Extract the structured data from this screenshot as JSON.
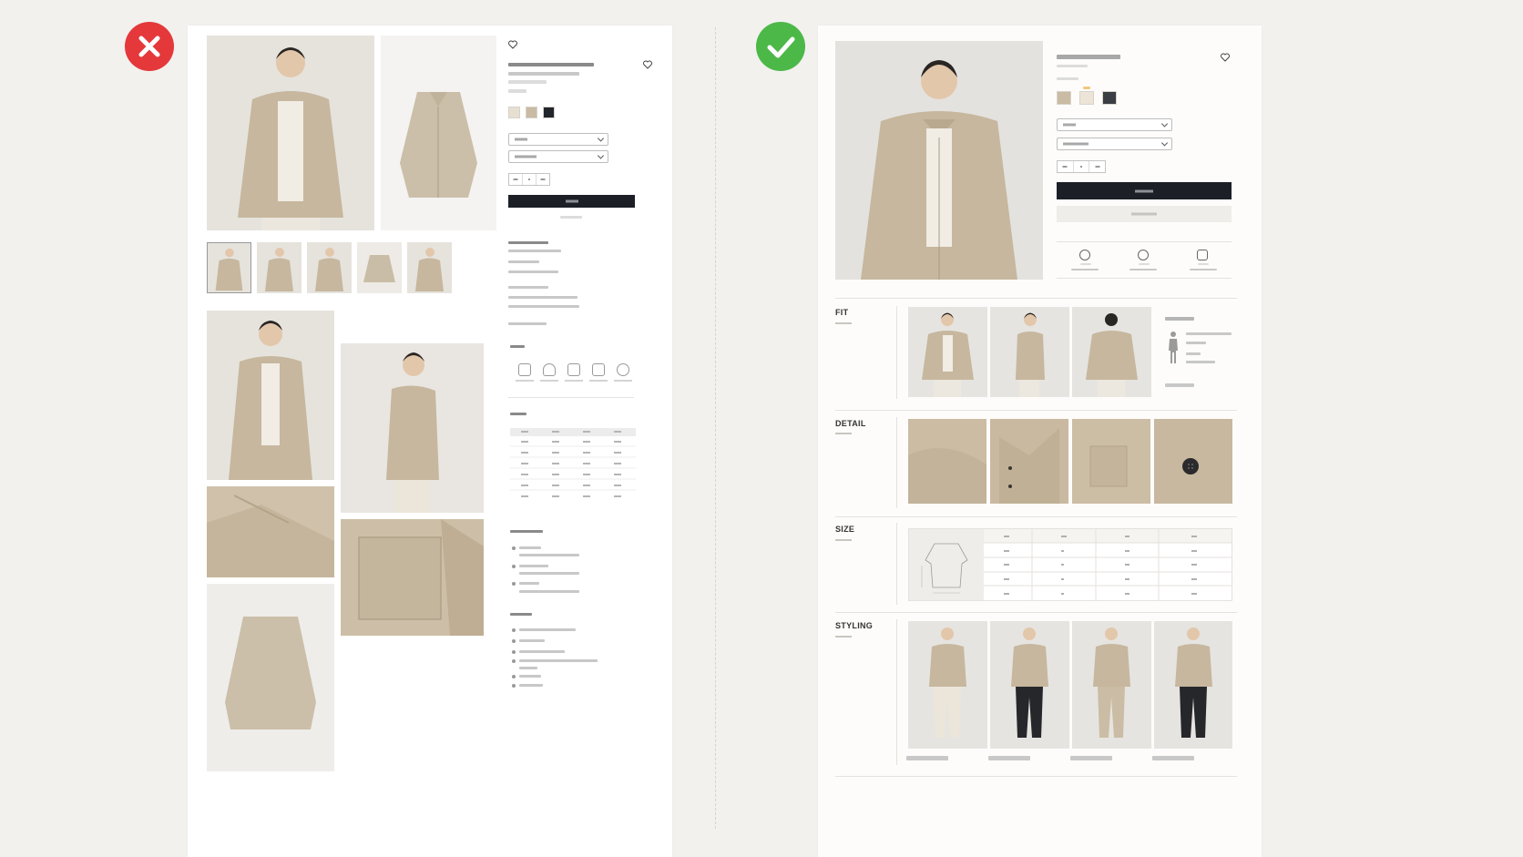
{
  "badges": {
    "bad": {
      "color": "#e5383b",
      "icon": "cross-icon"
    },
    "good": {
      "color": "#4cb848",
      "icon": "check-icon"
    }
  },
  "product_colors": {
    "beige": "#c9bba4",
    "light_beige": "#e7dfd2",
    "black": "#22252b"
  },
  "right": {
    "sections": {
      "fit": "FIT",
      "detail": "DETAIL",
      "size": "SIZE",
      "styling": "STYLING"
    }
  },
  "icons": {
    "heart": "heart-icon",
    "chevron": "chevron-down-icon",
    "wash": "wash-icon",
    "bleach": "bleach-icon",
    "dry": "tumble-dry-icon",
    "iron": "iron-icon",
    "dryclean": "dry-clean-icon",
    "shipping": "shipping-icon",
    "returns": "returns-icon",
    "secure": "shield-icon",
    "figure": "person-figure-icon"
  }
}
